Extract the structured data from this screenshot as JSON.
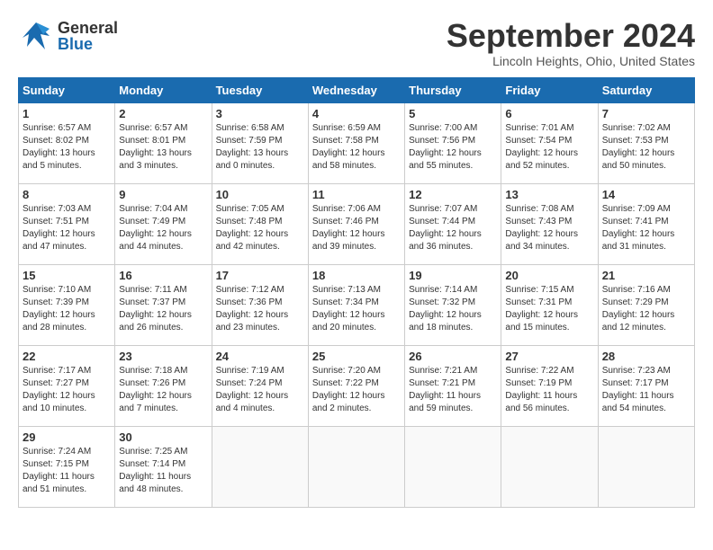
{
  "header": {
    "logo_general": "General",
    "logo_blue": "Blue",
    "month_title": "September 2024",
    "location": "Lincoln Heights, Ohio, United States"
  },
  "days_of_week": [
    "Sunday",
    "Monday",
    "Tuesday",
    "Wednesday",
    "Thursday",
    "Friday",
    "Saturday"
  ],
  "weeks": [
    [
      {
        "day": "1",
        "sunrise": "6:57 AM",
        "sunset": "8:02 PM",
        "daylight": "13 hours and 5 minutes."
      },
      {
        "day": "2",
        "sunrise": "6:57 AM",
        "sunset": "8:01 PM",
        "daylight": "13 hours and 3 minutes."
      },
      {
        "day": "3",
        "sunrise": "6:58 AM",
        "sunset": "7:59 PM",
        "daylight": "13 hours and 0 minutes."
      },
      {
        "day": "4",
        "sunrise": "6:59 AM",
        "sunset": "7:58 PM",
        "daylight": "12 hours and 58 minutes."
      },
      {
        "day": "5",
        "sunrise": "7:00 AM",
        "sunset": "7:56 PM",
        "daylight": "12 hours and 55 minutes."
      },
      {
        "day": "6",
        "sunrise": "7:01 AM",
        "sunset": "7:54 PM",
        "daylight": "12 hours and 52 minutes."
      },
      {
        "day": "7",
        "sunrise": "7:02 AM",
        "sunset": "7:53 PM",
        "daylight": "12 hours and 50 minutes."
      }
    ],
    [
      {
        "day": "8",
        "sunrise": "7:03 AM",
        "sunset": "7:51 PM",
        "daylight": "12 hours and 47 minutes."
      },
      {
        "day": "9",
        "sunrise": "7:04 AM",
        "sunset": "7:49 PM",
        "daylight": "12 hours and 44 minutes."
      },
      {
        "day": "10",
        "sunrise": "7:05 AM",
        "sunset": "7:48 PM",
        "daylight": "12 hours and 42 minutes."
      },
      {
        "day": "11",
        "sunrise": "7:06 AM",
        "sunset": "7:46 PM",
        "daylight": "12 hours and 39 minutes."
      },
      {
        "day": "12",
        "sunrise": "7:07 AM",
        "sunset": "7:44 PM",
        "daylight": "12 hours and 36 minutes."
      },
      {
        "day": "13",
        "sunrise": "7:08 AM",
        "sunset": "7:43 PM",
        "daylight": "12 hours and 34 minutes."
      },
      {
        "day": "14",
        "sunrise": "7:09 AM",
        "sunset": "7:41 PM",
        "daylight": "12 hours and 31 minutes."
      }
    ],
    [
      {
        "day": "15",
        "sunrise": "7:10 AM",
        "sunset": "7:39 PM",
        "daylight": "12 hours and 28 minutes."
      },
      {
        "day": "16",
        "sunrise": "7:11 AM",
        "sunset": "7:37 PM",
        "daylight": "12 hours and 26 minutes."
      },
      {
        "day": "17",
        "sunrise": "7:12 AM",
        "sunset": "7:36 PM",
        "daylight": "12 hours and 23 minutes."
      },
      {
        "day": "18",
        "sunrise": "7:13 AM",
        "sunset": "7:34 PM",
        "daylight": "12 hours and 20 minutes."
      },
      {
        "day": "19",
        "sunrise": "7:14 AM",
        "sunset": "7:32 PM",
        "daylight": "12 hours and 18 minutes."
      },
      {
        "day": "20",
        "sunrise": "7:15 AM",
        "sunset": "7:31 PM",
        "daylight": "12 hours and 15 minutes."
      },
      {
        "day": "21",
        "sunrise": "7:16 AM",
        "sunset": "7:29 PM",
        "daylight": "12 hours and 12 minutes."
      }
    ],
    [
      {
        "day": "22",
        "sunrise": "7:17 AM",
        "sunset": "7:27 PM",
        "daylight": "12 hours and 10 minutes."
      },
      {
        "day": "23",
        "sunrise": "7:18 AM",
        "sunset": "7:26 PM",
        "daylight": "12 hours and 7 minutes."
      },
      {
        "day": "24",
        "sunrise": "7:19 AM",
        "sunset": "7:24 PM",
        "daylight": "12 hours and 4 minutes."
      },
      {
        "day": "25",
        "sunrise": "7:20 AM",
        "sunset": "7:22 PM",
        "daylight": "12 hours and 2 minutes."
      },
      {
        "day": "26",
        "sunrise": "7:21 AM",
        "sunset": "7:21 PM",
        "daylight": "11 hours and 59 minutes."
      },
      {
        "day": "27",
        "sunrise": "7:22 AM",
        "sunset": "7:19 PM",
        "daylight": "11 hours and 56 minutes."
      },
      {
        "day": "28",
        "sunrise": "7:23 AM",
        "sunset": "7:17 PM",
        "daylight": "11 hours and 54 minutes."
      }
    ],
    [
      {
        "day": "29",
        "sunrise": "7:24 AM",
        "sunset": "7:15 PM",
        "daylight": "11 hours and 51 minutes."
      },
      {
        "day": "30",
        "sunrise": "7:25 AM",
        "sunset": "7:14 PM",
        "daylight": "11 hours and 48 minutes."
      },
      null,
      null,
      null,
      null,
      null
    ]
  ]
}
